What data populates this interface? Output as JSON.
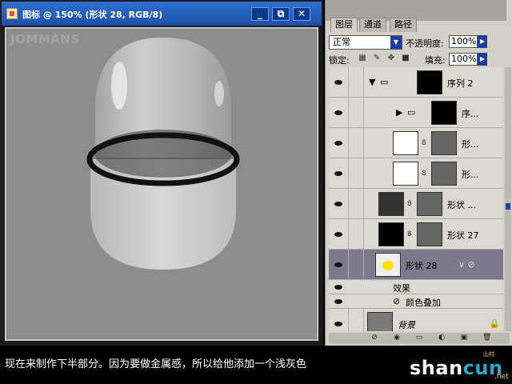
{
  "document": {
    "title": "图标 @ 150% (形状 28, RGB/8)",
    "watermark": "JOMMANS",
    "controls": {
      "minimize": "_",
      "restore": "⧉",
      "close": "✕"
    }
  },
  "layers_panel": {
    "tabs": [
      "图层",
      "通道",
      "路径"
    ],
    "active_tab": "图层",
    "blend_mode": "正常",
    "opacity_label": "不透明度:",
    "opacity_value": "100%",
    "lock_label": "锁定:",
    "fill_label": "填充:",
    "fill_value": "100%",
    "layers": [
      {
        "name": "序列 2",
        "type": "group-expanded"
      },
      {
        "name": "序...",
        "type": "group-collapsed"
      },
      {
        "name": "形...",
        "type": "shape"
      },
      {
        "name": "形...",
        "type": "shape"
      },
      {
        "name": "形状 ...",
        "type": "shape"
      },
      {
        "name": "形状 27",
        "type": "shape"
      },
      {
        "name": "形状 28",
        "type": "shape-selected"
      },
      {
        "name": "效果",
        "type": "effects"
      },
      {
        "name": "颜色叠加",
        "type": "effect-item"
      },
      {
        "name": "背景",
        "type": "background"
      }
    ]
  },
  "caption": "现在来制作下半部分。因为要做金属感，所以给他添加一个浅灰色",
  "brand": {
    "part1": "shan",
    "part2": "cun",
    "small": "山村",
    "net": ".net"
  },
  "colors": {
    "titlebar": "#2d6fd0",
    "canvas_bg": "#8d8d8d",
    "panel_bg": "#d4d0c8"
  }
}
